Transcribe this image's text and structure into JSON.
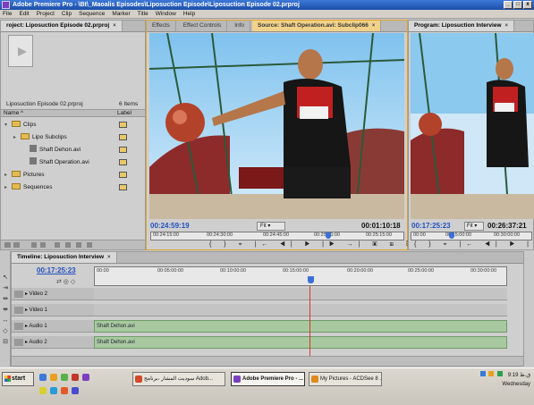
{
  "window": {
    "title": "Adobe Premiere Pro - \\Bt\\_Maoalis Episodes\\Liposuction Episode\\Liposuction Episode 02.prproj"
  },
  "menu": [
    "File",
    "Edit",
    "Project",
    "Clip",
    "Sequence",
    "Marker",
    "Title",
    "Window",
    "Help"
  ],
  "project": {
    "tab": "roject: Liposuction Episode 02.prproj",
    "file_name": "Liposuction Episode 02.prproj",
    "items_count": "6 Items",
    "col_name": "Name",
    "col_label": "Label",
    "tree": [
      {
        "label": "Clips",
        "type": "folder",
        "color": "#e8c86a",
        "indent": 0
      },
      {
        "label": "Lipo Subclips",
        "type": "folder",
        "color": "#e8c86a",
        "indent": 1
      },
      {
        "label": "Shaft Dehon.avi",
        "type": "media",
        "color": "#e8c86a",
        "indent": 2
      },
      {
        "label": "Shaft Operation.avi",
        "type": "media",
        "color": "#e8c86a",
        "indent": 2
      },
      {
        "label": "Pictures",
        "type": "folder",
        "color": "#e8c86a",
        "indent": 0
      },
      {
        "label": "Sequences",
        "type": "folder",
        "color": "#e8c86a",
        "indent": 0
      }
    ]
  },
  "source": {
    "tabs": [
      "Effects",
      "Effect Controls",
      "Info",
      "Source: Shaft Operation.avi: Subclip066"
    ],
    "timecode_in": "00:24:59:19",
    "fit": "Fit",
    "timecode_dur": "00:01:10:18",
    "ruler": [
      "00:24:15:00",
      "00:24:30:00",
      "00:24:45:00",
      "00:25:00:00",
      "00:25:15:00"
    ],
    "controls_row1": "{ } ⌖ |← ◀| ▶ |▶ →| ▣ ⊞ ⎘",
    "controls_row2": "{← →} {⇔} ▭▭▭ ⊞ ⊟ ⊡"
  },
  "program": {
    "tab": "Program: Liposuction Interview",
    "timecode": "00:17:25:23",
    "fit": "Fit",
    "timecode_dur": "00:26:37:21",
    "ruler": [
      "00:00",
      "00:15:00:00",
      "00:30:00:00"
    ]
  },
  "timeline": {
    "tab": "Timeline: Liposuction Interview",
    "timecode": "00:17:25:23",
    "ruler": [
      "00:00",
      "00:05:00:00",
      "00:10:00:00",
      "00:15:00:00",
      "00:20:00:00",
      "00:25:00:00",
      "00:30:00:00"
    ],
    "tracks": [
      {
        "name": "Video 2",
        "clip": ""
      },
      {
        "name": "Video 1",
        "clip": ""
      },
      {
        "name": "Audio 1",
        "clip": "Shaft Dehon.avi"
      },
      {
        "name": "Audio 2",
        "clip": "Shaft Dehon.avi"
      }
    ]
  },
  "taskbar": {
    "start": "start",
    "tasks": [
      {
        "label": "سوديت المشار ،برنامج Adob...",
        "color": "#d34a2a"
      },
      {
        "label": "Adobe Premiere Pro - ...",
        "color": "#7a3fbf"
      },
      {
        "label": "My Pictures - ACDSee 8 ...",
        "color": "#e08a1e"
      }
    ],
    "time": "9:19 ق.ظ",
    "day": "Wednesday"
  }
}
